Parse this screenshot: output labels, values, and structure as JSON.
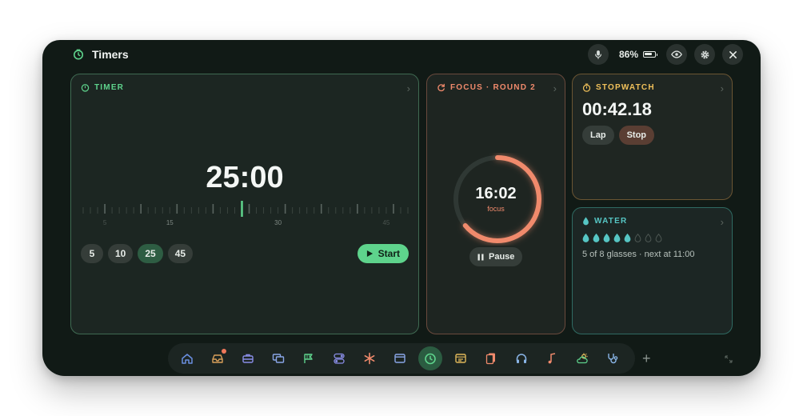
{
  "app": {
    "title": "Timers",
    "battery": "86%",
    "battery_level": 0.86
  },
  "colors": {
    "timer": "#5ed38c",
    "focus": "#f08a6c",
    "stopwatch": "#f0c05a",
    "water": "#56c6c4"
  },
  "timer": {
    "title": "TIMER",
    "value": "25:00",
    "scale_labels": [
      "5",
      "15",
      "30",
      "45"
    ],
    "presets": [
      "5",
      "10",
      "25",
      "45"
    ],
    "selected_preset": "25",
    "start_label": "Start"
  },
  "focus": {
    "title": "FOCUS · ROUND 2",
    "time": "16:02",
    "mode": "focus",
    "progress": 0.64,
    "pause_label": "Pause"
  },
  "stopwatch": {
    "title": "STOPWATCH",
    "value": "00:42.18",
    "lap_label": "Lap",
    "stop_label": "Stop"
  },
  "water": {
    "title": "WATER",
    "glasses_filled": 5,
    "glasses_total": 8,
    "status": "5 of 8 glasses · next at 11:00"
  },
  "dock": {
    "items": [
      "home-icon",
      "inbox-icon",
      "briefcase-icon",
      "windows-icon",
      "flag-icon",
      "toggles-icon",
      "asterisk-icon",
      "browser-icon",
      "timer-icon",
      "notes-icon",
      "cards-icon",
      "headphones-icon",
      "music-note-icon",
      "weather-icon",
      "stethoscope-icon"
    ],
    "active": "timer-icon",
    "add_label": "+"
  }
}
